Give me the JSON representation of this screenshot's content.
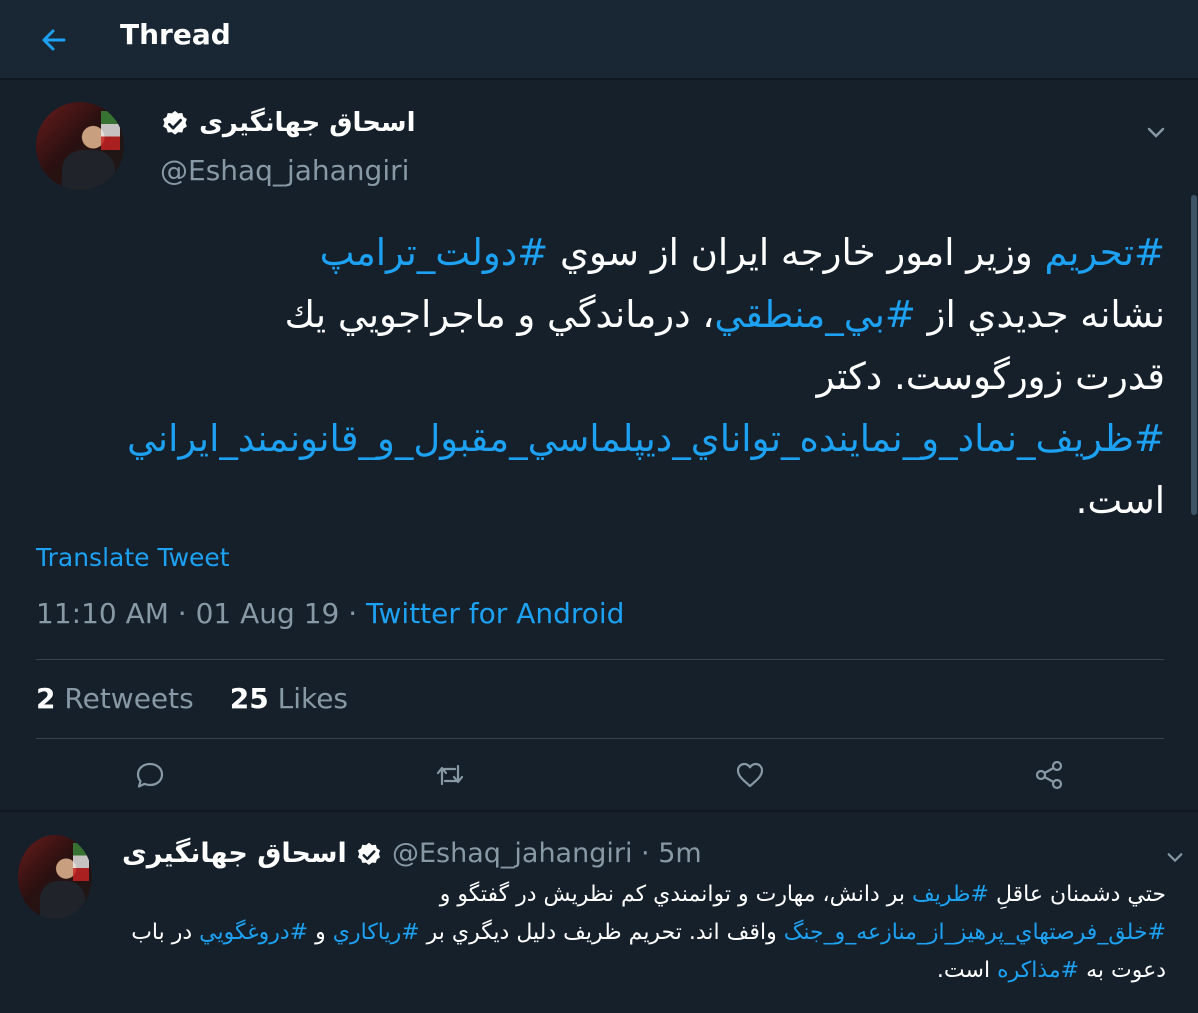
{
  "header": {
    "title": "Thread"
  },
  "tweet": {
    "author_name": "اسحاق جهانگیری",
    "handle": "@Eshaq_jahangiri",
    "segments": [
      {
        "text": "#تحريم",
        "tag": true
      },
      {
        "text": " وزير امور خارجه ايران از سوي ",
        "tag": false
      },
      {
        "text": "#دولت_ترامپ",
        "tag": true
      },
      {
        "text": " نشانه جديدي از ",
        "tag": false
      },
      {
        "text": "#بي_منطقي",
        "tag": true
      },
      {
        "text": "، درماندگي و ماجراجويي يك قدرت زورگوست. دكتر ",
        "tag": false
      },
      {
        "text": "#ظريف_نماد_و_نماينده_تواناي_ديپلماسي_مقبول_و_قانونمند_ايراني",
        "tag": true
      },
      {
        "text": " است.",
        "tag": false
      }
    ],
    "translate_label": "Translate Tweet",
    "time": "11:10 AM",
    "date": "01 Aug 19",
    "separator": " · ",
    "source": "Twitter for Android",
    "retweets_count": "2",
    "retweets_label": "Retweets",
    "likes_count": "25",
    "likes_label": "Likes"
  },
  "actions": [
    "reply-icon",
    "retweet-icon",
    "like-icon",
    "share-icon"
  ],
  "reply": {
    "author_name": "اسحاق جهانگیری",
    "handle": "@Eshaq_jahangiri",
    "age": "· 5m",
    "segments": [
      {
        "text": "حتي دشمنان عاقلِ ",
        "tag": false
      },
      {
        "text": "#ظريف",
        "tag": true
      },
      {
        "text": " بر دانش، مهارت و توانمندي كم نظريش در گفتگو و ",
        "tag": false
      },
      {
        "text": "#خلق_فرصتهاي_پرهيز_از_منازعه_و_جنگ",
        "tag": true
      },
      {
        "text": " واقف اند. تحريم ظريف دليل ديگري بر ",
        "tag": false
      },
      {
        "text": "#رياكاري",
        "tag": true
      },
      {
        "text": " و ",
        "tag": false
      },
      {
        "text": "#دروغگويي",
        "tag": true
      },
      {
        "text": " در باب دعوت به ",
        "tag": false
      },
      {
        "text": "#مذاكره",
        "tag": true
      },
      {
        "text": " است.",
        "tag": false
      }
    ]
  },
  "colors": {
    "background": "#15202b",
    "header": "#192734",
    "accent": "#1da1f2",
    "muted": "#8899a6",
    "divider": "#38444d"
  }
}
